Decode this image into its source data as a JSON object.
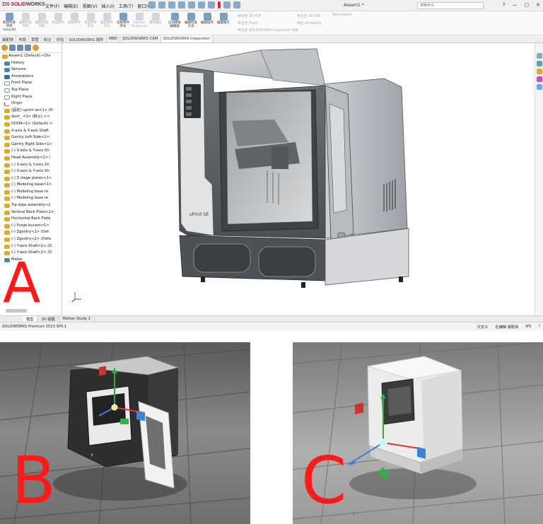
{
  "panel_a": {
    "app_name_red": "SOLID",
    "app_name_dark": "WORKS",
    "menu": [
      "文件(F)",
      "编辑(E)",
      "视图(V)",
      "插入(I)",
      "工具(T)",
      "窗口(W)"
    ],
    "doc_title": "Assem1 *",
    "search_placeholder": "搜索命令",
    "window_buttons": [
      "?",
      "—",
      "▢",
      "✕"
    ],
    "commands": [
      {
        "label": "新建检查项目 (amp;N)",
        "dim": false
      },
      {
        "label": "编辑检查项目",
        "dim": true
      },
      {
        "label": "编辑检查项目",
        "dim": true
      },
      {
        "label": "添加零件",
        "dim": true
      },
      {
        "label": "编辑零件",
        "dim": true
      },
      {
        "label": "添加零件序号",
        "dim": true
      },
      {
        "label": "编辑零件序号",
        "dim": true
      },
      {
        "label": "选择零件序号",
        "dim": false
      },
      {
        "label": "Balloon Sequence",
        "dim": true
      },
      {
        "label": "重新编号",
        "dim": true
      },
      {
        "label": "启动模板编辑器",
        "dim": false
      },
      {
        "label": "编辑检查方式",
        "dim": false
      },
      {
        "label": "编辑操作",
        "dim": false
      },
      {
        "label": "编辑报告",
        "dim": false
      }
    ],
    "inspection_exports": [
      "导出至 3D PDF",
      "导出至 Excel",
      "导出至 SOLIDWORKS Inspection 项目",
      "导出至 3D PDF",
      "导出 eDrawing",
      "Net-Inspect"
    ],
    "tabs": [
      "装配体",
      "布局",
      "草图",
      "标注",
      "评估",
      "SOLIDWORKS 插件",
      "MBD",
      "SOLIDWORKS CAM",
      "SOLIDWORKS Inspection"
    ],
    "active_tab": "SOLIDWORKS Inspection",
    "tree_top": "Assem1 (Default) <Dis",
    "tree_items": [
      {
        "label": "History",
        "icon": "history-icon"
      },
      {
        "label": "Sensors",
        "icon": "sensor-icon"
      },
      {
        "label": "Annotations",
        "icon": "annotation-icon"
      },
      {
        "label": "Front Plane",
        "icon": "plane-icon"
      },
      {
        "label": "Top Plane",
        "icon": "plane-icon"
      },
      {
        "label": "Right Plane",
        "icon": "plane-icon"
      },
      {
        "label": "Origin",
        "icon": "origin-icon"
      },
      {
        "label": "(固定) uprint se<1> (D",
        "icon": "part-icon"
      },
      {
        "label": "door_ <1> (默认) <<",
        "icon": "part-icon"
      },
      {
        "label": "DOOR<1> (Default) <",
        "icon": "part-icon"
      },
      {
        "label": "X-axis & Y-axis Shaft",
        "icon": "part-icon"
      },
      {
        "label": "Gantry Left Side<1>",
        "icon": "part-icon"
      },
      {
        "label": "Gantry Right Side<1>",
        "icon": "part-icon"
      },
      {
        "label": "(-) X-axis & Y-axis Sh",
        "icon": "part-icon"
      },
      {
        "label": "Head Assembly<1> (",
        "icon": "part-icon"
      },
      {
        "label": "(-) X-axis & Y-axis Sh",
        "icon": "part-icon"
      },
      {
        "label": "(-) X-axis & Y-axis Sh",
        "icon": "part-icon"
      },
      {
        "label": "(-) Z stage platen<1>",
        "icon": "part-icon"
      },
      {
        "label": "(-) Modeling base<1>",
        "icon": "part-icon"
      },
      {
        "label": "(-) Modeling base re",
        "icon": "part-icon"
      },
      {
        "label": "(-) Modeling base re",
        "icon": "part-icon"
      },
      {
        "label": "Tip wipe assembly<1",
        "icon": "part-icon"
      },
      {
        "label": "Vertical Back Plate<1>",
        "icon": "part-icon"
      },
      {
        "label": "Horizontal Back Plate",
        "icon": "part-icon"
      },
      {
        "label": "(-) Purge bucket<1>",
        "icon": "part-icon"
      },
      {
        "label": "(-) Zgentry<1> (Def",
        "icon": "part-icon"
      },
      {
        "label": "(-) Zgentry<2> (Defa",
        "icon": "part-icon"
      },
      {
        "label": "(-) Y-axis Shaft<1> (D",
        "icon": "part-icon"
      },
      {
        "label": "(-) Y-axis Shaft<2> (D",
        "icon": "part-icon"
      },
      {
        "label": "Mates",
        "icon": "mates-icon"
      }
    ],
    "bottom_tabs": [
      "模型",
      "3D 视图",
      "Motion Study 1"
    ],
    "status_left": "SOLIDWORKS Premium 2023 SP0.1",
    "status_right": [
      "欠定义",
      "在编辑 装配体",
      "IPS",
      "?"
    ],
    "printer_brand": "uPrint SE",
    "label": "A"
  },
  "panel_b": {
    "label": "B"
  },
  "panel_c": {
    "label": "C"
  }
}
